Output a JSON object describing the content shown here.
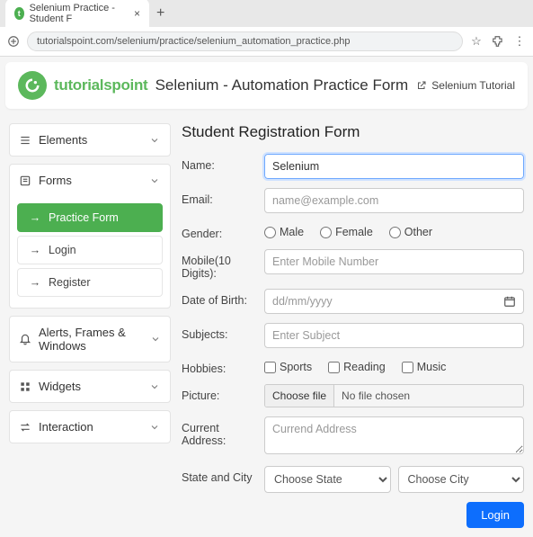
{
  "browser": {
    "tab_title": "Selenium Practice - Student F",
    "url": "tutorialspoint.com/selenium/practice/selenium_automation_practice.php"
  },
  "header": {
    "brand": "tutorialspoint",
    "title": "Selenium - Automation Practice Form",
    "link": "Selenium Tutorial"
  },
  "sidebar": {
    "sections": {
      "elements": "Elements",
      "forms": "Forms",
      "alerts": "Alerts, Frames & Windows",
      "widgets": "Widgets",
      "interaction": "Interaction"
    },
    "forms_items": {
      "practice": "Practice Form",
      "login": "Login",
      "register": "Register"
    }
  },
  "form": {
    "heading": "Student Registration Form",
    "labels": {
      "name": "Name:",
      "email": "Email:",
      "gender": "Gender:",
      "mobile": "Mobile(10 Digits):",
      "dob": "Date of Birth:",
      "subjects": "Subjects:",
      "hobbies": "Hobbies:",
      "picture": "Picture:",
      "address": "Current Address:",
      "statecity": "State and City"
    },
    "values": {
      "name": "Selenium"
    },
    "placeholders": {
      "email": "name@example.com",
      "mobile": "Enter Mobile Number",
      "dob": "dd/mm/yyyy",
      "subjects": "Enter Subject",
      "address": "Currend Address"
    },
    "gender_options": {
      "male": "Male",
      "female": "Female",
      "other": "Other"
    },
    "hobby_options": {
      "sports": "Sports",
      "reading": "Reading",
      "music": "Music"
    },
    "file": {
      "button": "Choose file",
      "status": "No file chosen"
    },
    "state_default": "Choose State",
    "city_default": "Choose City",
    "submit": "Login"
  }
}
